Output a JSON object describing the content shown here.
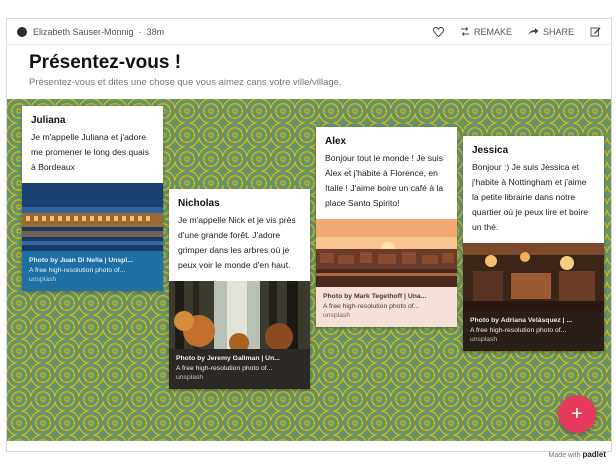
{
  "topbar": {
    "author": "Elizabeth Sauser-Monnig",
    "separator": "·",
    "time": "38m",
    "remake_label": "REMAKE",
    "share_label": "SHARE"
  },
  "page": {
    "title": "Présentez-vous !",
    "subtitle": "Présentez-vous et dites une chose que vous aimez cans votre ville/village."
  },
  "cards": [
    {
      "name": "Juliana",
      "text": "Je m'appelle Juliana et j'adore me promener le long des quais à Bordeaux",
      "photo_credit": "Photo by Juan Di Nella | Unspl...",
      "photo_desc": "A free high-resolution photo of...",
      "photo_source": "unsplash",
      "image": "bordeaux-waterfront-night"
    },
    {
      "name": "Nicholas",
      "text": "Je m'appelle Nick et je vis près d'une grande forêt. J'adore grimper dans les arbres où je peux voir le monde d'en haut.",
      "photo_credit": "Photo by Jeremy Gallman | Un...",
      "photo_desc": "A free high-resolution photo of...",
      "photo_source": "unsplash",
      "image": "forest-sunlight"
    },
    {
      "name": "Alex",
      "text": "Bonjour tout le monde ! Je suis Alex et j'habite à Florence, en Italie ! J'aime boire un café à la place Santo Spirito!",
      "photo_credit": "Photo by Mark Tegethoff | Una...",
      "photo_desc": "A free high-resolution photo of...",
      "photo_source": "unsplash",
      "image": "florence-sunset"
    },
    {
      "name": "Jessica",
      "text": "Bonjour :) Je suis Jessica et j'habite à Nottingham et j'aime la petite librairie dans notre quartier où je peux lire et boire un thé.",
      "photo_credit": "Photo by Adriana Velásquez | ...",
      "photo_desc": "A free high-resolution photo of...",
      "photo_source": "unsplash",
      "image": "bookshop-cafe-interior"
    }
  ],
  "fab": {
    "label": "+"
  },
  "footer": {
    "made_with": "Made with",
    "brand": "padlet"
  },
  "colors": {
    "accent": "#e53a5c",
    "wall_green": "#6e9a3f",
    "wall_gold": "#d9b43e",
    "wall_blue": "#5a8cb2"
  },
  "icons": [
    "avatar-icon",
    "heart-icon",
    "remake-icon",
    "share-icon",
    "edit-icon"
  ]
}
